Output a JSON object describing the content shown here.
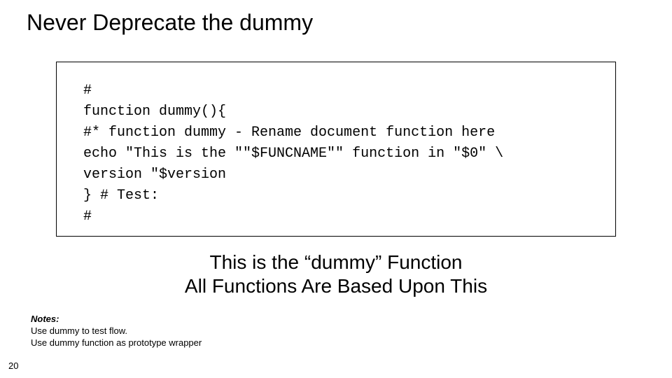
{
  "title": "Never Deprecate the dummy",
  "code": "#\nfunction dummy(){\n#* function dummy - Rename document function here\necho \"This is the \"\"$FUNCNAME\"\" function in \"$0\" \\\nversion \"$version\n} # Test:\n#",
  "subtitle": "This is the “dummy” Function\nAll Functions Are Based Upon This",
  "notes": {
    "heading": "Notes:",
    "line1": "Use dummy to test flow.",
    "line2": "Use dummy function as prototype wrapper"
  },
  "page_number": "20"
}
